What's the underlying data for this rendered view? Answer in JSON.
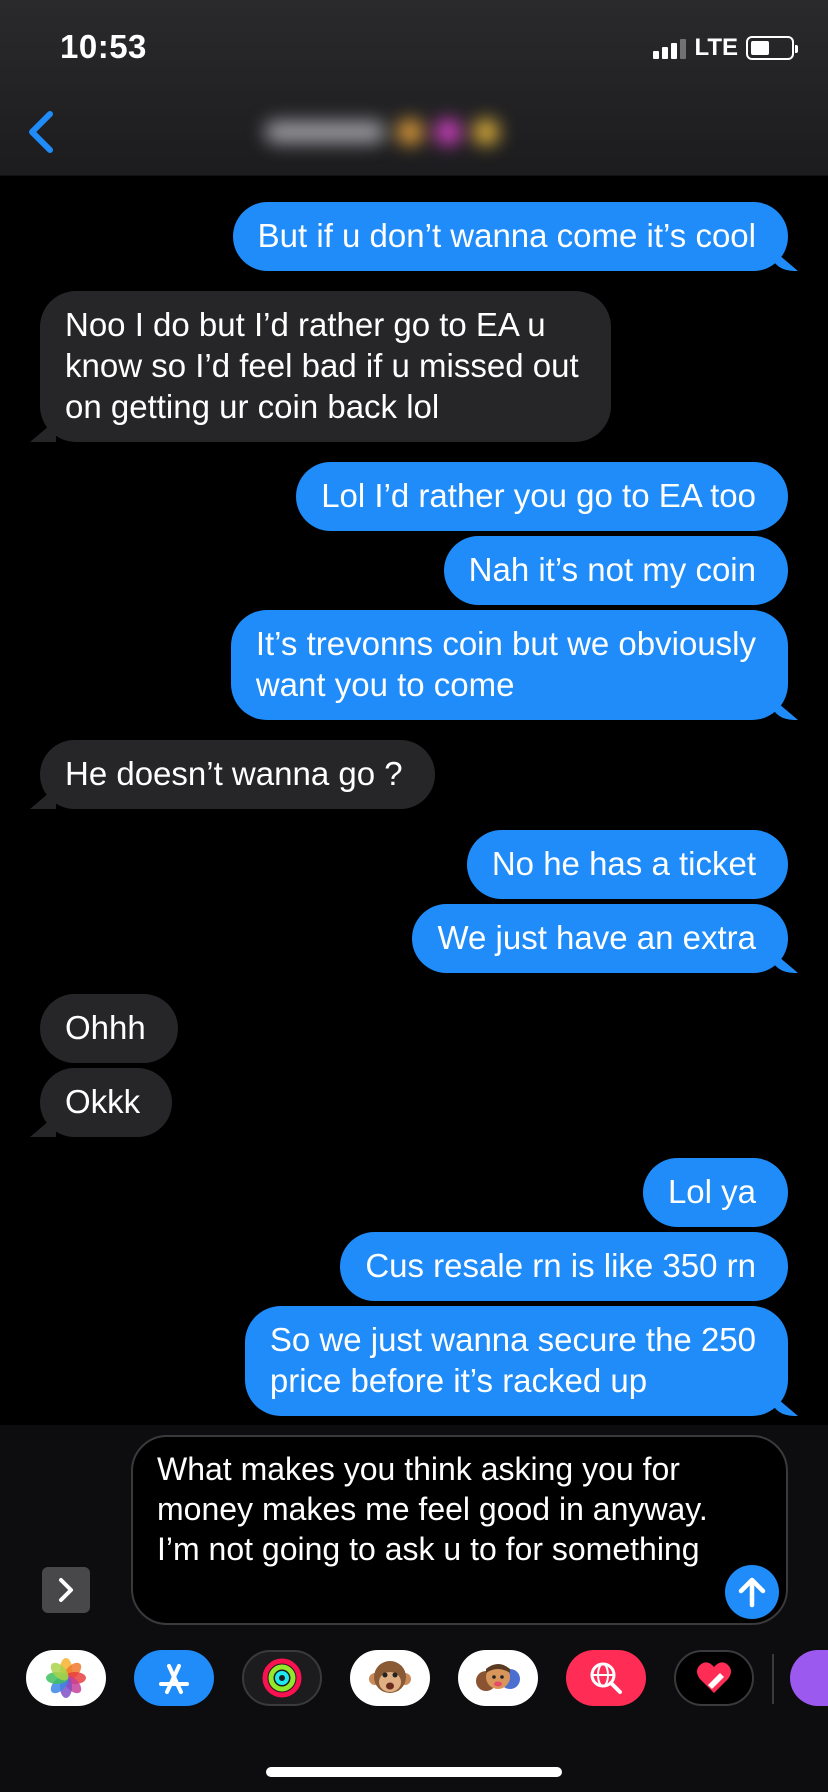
{
  "status_bar": {
    "time": "10:53",
    "network": "LTE"
  },
  "header": {
    "back_icon": "chevron-left-icon"
  },
  "messages": [
    {
      "dir": "out",
      "text": "But if u don’t wanna come it’s cool"
    },
    {
      "dir": "in",
      "text": "Noo I do but I’d rather go to EA u\nknow so I’d feel bad if u missed out\non getting ur coin back lol"
    },
    {
      "dir": "out",
      "text": "Lol I’d rather you go to EA too"
    },
    {
      "dir": "out",
      "text": "Nah it’s not my coin"
    },
    {
      "dir": "out",
      "text": "It’s trevonns coin but we obviously\nwant you to come"
    },
    {
      "dir": "in",
      "text": "He doesn’t wanna go ?"
    },
    {
      "dir": "out",
      "text": "No he has a ticket"
    },
    {
      "dir": "out",
      "text": "We just have an extra"
    },
    {
      "dir": "in",
      "text": "Ohhh"
    },
    {
      "dir": "in",
      "text": "Okkk"
    },
    {
      "dir": "out",
      "text": "Lol ya"
    },
    {
      "dir": "out",
      "text": "Cus resale rn is like 350 rn"
    },
    {
      "dir": "out",
      "text": "So we just wanna secure the 250\nprice before it’s racked up"
    }
  ],
  "composer": {
    "text": "What makes you think asking you for money makes me feel good in anyway. I’m not going to ask u to for something",
    "expand_icon": "chevron-right-icon",
    "send_icon": "arrow-up-icon"
  },
  "app_drawer": [
    {
      "name": "photos-app-icon",
      "color": "#ffffff"
    },
    {
      "name": "app-store-icon",
      "color": "#1f8cf9"
    },
    {
      "name": "activity-icon",
      "color": "#1c1c1e"
    },
    {
      "name": "animoji-icon",
      "color": "#ffffff"
    },
    {
      "name": "memoji-icon",
      "color": "#ffffff"
    },
    {
      "name": "web-search-icon",
      "color": "#ff2d55"
    },
    {
      "name": "digital-touch-icon",
      "color": "#000000"
    }
  ]
}
